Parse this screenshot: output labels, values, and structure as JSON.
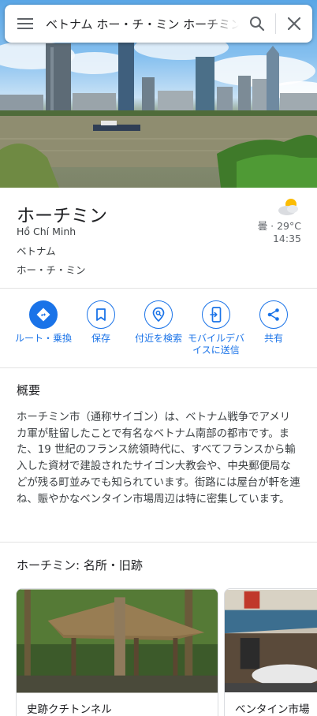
{
  "search": {
    "query": "ベトナム ホー・チ・ミン ホーチミン"
  },
  "place": {
    "title": "ホーチミン",
    "native_name": "Hồ Chí Minh",
    "country": "ベトナム",
    "reading": "ホー・チ・ミン"
  },
  "weather": {
    "icon": "partly-cloudy-icon",
    "text": "曇 · 29°C",
    "time": "14:35"
  },
  "actions": [
    {
      "label": "ルート・乗換",
      "icon": "directions-icon"
    },
    {
      "label": "保存",
      "icon": "bookmark-icon"
    },
    {
      "label": "付近を検索",
      "icon": "nearby-icon"
    },
    {
      "label_line1": "モバイルデバ",
      "label_line2": "イスに送信",
      "icon": "send-to-phone-icon"
    },
    {
      "label": "共有",
      "icon": "share-icon"
    }
  ],
  "overview": {
    "heading": "概要",
    "body": "ホーチミン市（通称サイゴン）は、ベトナム戦争でアメリカ軍が駐留したことで有名なベトナム南部の都市です。また、19 世紀のフランス統領時代に、すべてフランスから輸入した資材で建設されたサイゴン大教会や、中央郵便局などが残る町並みでも知られています。街路には屋台が軒を連ね、賑やかなベンタイン市場周辺は特に密集しています。"
  },
  "sights": {
    "heading": "ホーチミン: 名所・旧跡",
    "cards": [
      {
        "title": "史跡クチトンネル"
      },
      {
        "title": "ベンタイン市場"
      }
    ]
  },
  "colors": {
    "accent": "#1a73e8",
    "text": "#202124",
    "secondary_text": "#5f6368",
    "divider": "#e3e3e3"
  }
}
